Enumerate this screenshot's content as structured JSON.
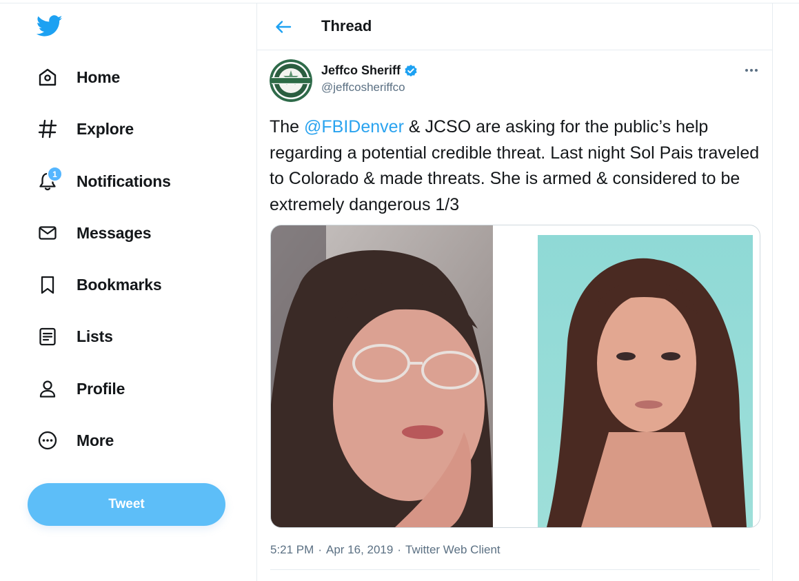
{
  "sidebar": {
    "logo_icon": "twitter-bird-icon",
    "items": [
      {
        "label": "Home",
        "icon": "home-icon"
      },
      {
        "label": "Explore",
        "icon": "hashtag-icon"
      },
      {
        "label": "Notifications",
        "icon": "bell-icon",
        "badge": "1"
      },
      {
        "label": "Messages",
        "icon": "envelope-icon"
      },
      {
        "label": "Bookmarks",
        "icon": "bookmark-icon"
      },
      {
        "label": "Lists",
        "icon": "list-icon"
      },
      {
        "label": "Profile",
        "icon": "person-icon"
      },
      {
        "label": "More",
        "icon": "more-circle-icon"
      }
    ],
    "tweet_button": "Tweet"
  },
  "header": {
    "title": "Thread",
    "back_icon": "arrow-left-icon"
  },
  "tweet": {
    "author_name": "Jeffco Sheriff",
    "author_handle": "@jeffcosheriffco",
    "verified": true,
    "text_before": "The ",
    "mention": "@FBIDenver",
    "text_after": " & JCSO are asking for the public’s help regarding a potential credible threat. Last night Sol Pais traveled to Colorado & made threats. She is armed & considered to be extremely dangerous 1/3",
    "time": "5:21 PM",
    "date": "Apr 16, 2019",
    "source": "Twitter Web Client",
    "separator": "·"
  },
  "colors": {
    "accent": "#1da1f2",
    "button": "#5dbef8",
    "secondary_text": "#5b7083"
  }
}
